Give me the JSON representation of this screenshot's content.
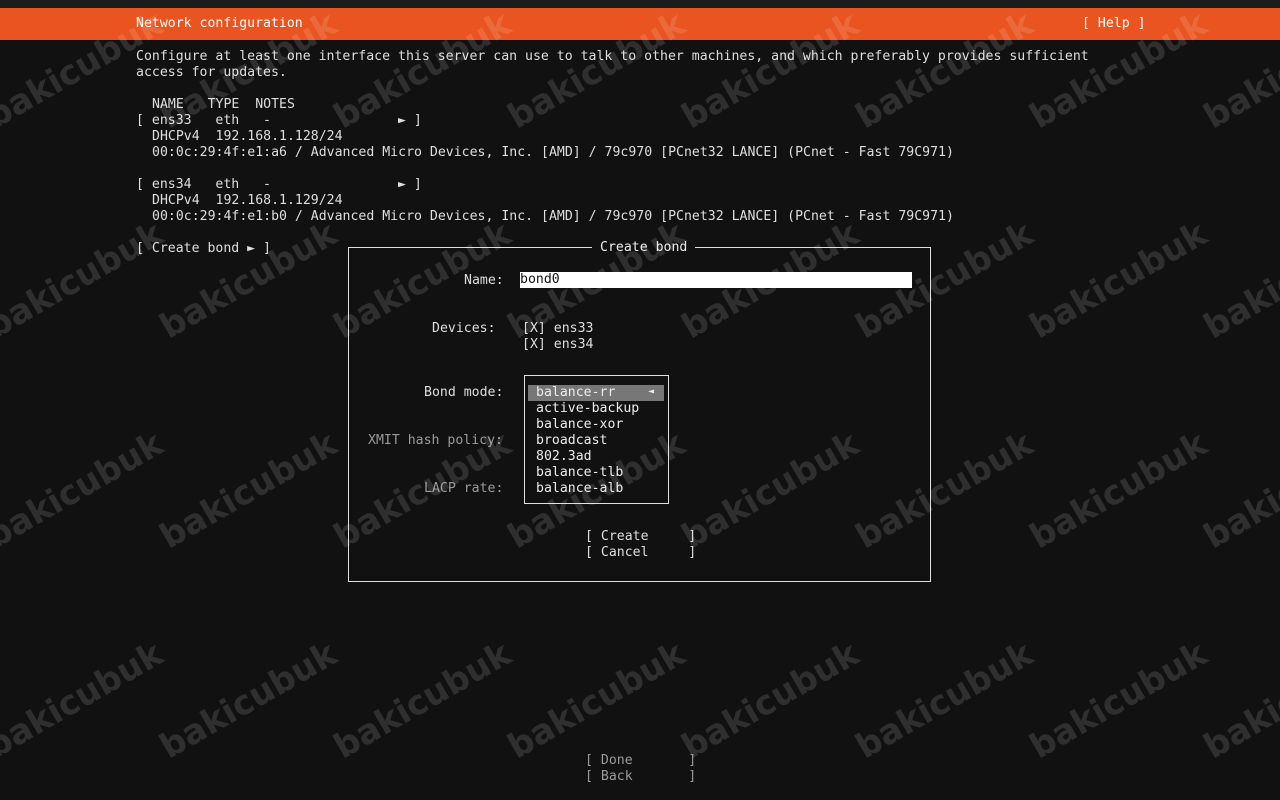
{
  "header": {
    "title": "Network configuration",
    "help": "[ Help ]"
  },
  "intro": {
    "line1": "Configure at least one interface this server can use to talk to other machines, and which preferably provides sufficient",
    "line2": "access for updates."
  },
  "table": {
    "header": "NAME   TYPE  NOTES",
    "interfaces": [
      {
        "row": "[ ens33   eth   -                ► ]",
        "addr": "DHCPv4  192.168.1.128/24",
        "hw": "00:0c:29:4f:e1:a6 / Advanced Micro Devices, Inc. [AMD] / 79c970 [PCnet32 LANCE] (PCnet - Fast 79C971)"
      },
      {
        "row": "[ ens34   eth   -                ► ]",
        "addr": "DHCPv4  192.168.1.129/24",
        "hw": "00:0c:29:4f:e1:b0 / Advanced Micro Devices, Inc. [AMD] / 79c970 [PCnet32 LANCE] (PCnet - Fast 79C971)"
      }
    ],
    "create_bond": "[ Create bond ► ]"
  },
  "dialog": {
    "title": "Create bond",
    "name_label": "Name:",
    "name_value": "bond0",
    "devices_label": "Devices:",
    "devices": [
      "[X] ens33",
      "[X] ens34"
    ],
    "bond_mode_label": "Bond mode:",
    "xmit_label": "XMIT hash policy:",
    "lacp_label": "LACP rate:",
    "bond_modes": [
      "balance-rr",
      "active-backup",
      "balance-xor",
      "broadcast",
      "802.3ad",
      "balance-tlb",
      "balance-alb"
    ],
    "selected_arrow": "◄",
    "create": "[ Create     ]",
    "cancel": "[ Cancel     ]"
  },
  "footer": {
    "done": "[ Done       ]",
    "back": "[ Back       ]"
  },
  "watermark": "bakicubuk",
  "colors": {
    "accent": "#e95420",
    "background": "#111111"
  }
}
